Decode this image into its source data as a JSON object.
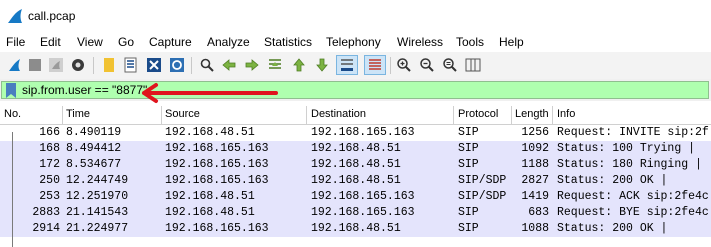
{
  "window": {
    "title": "call.pcap"
  },
  "menu": [
    "File",
    "Edit",
    "View",
    "Go",
    "Capture",
    "Analyze",
    "Statistics",
    "Telephony",
    "Wireless",
    "Tools",
    "Help"
  ],
  "toolbar": {
    "icons": [
      "start-capture-icon",
      "stop-capture-icon",
      "restart-capture-icon",
      "capture-options-icon",
      "open-file-icon",
      "save-file-icon",
      "close-file-icon",
      "reload-file-icon",
      "find-packet-icon",
      "go-back-icon",
      "go-forward-icon",
      "go-to-packet-icon",
      "go-first-icon",
      "go-last-icon",
      "autoscroll-icon",
      "colorize-icon",
      "zoom-in-icon",
      "zoom-out-icon",
      "normal-size-icon",
      "resize-columns-icon"
    ]
  },
  "filter": {
    "value": "sip.from.user == \"8877\""
  },
  "columns": [
    "No.",
    "Time",
    "Source",
    "Destination",
    "Protocol",
    "Length",
    "Info"
  ],
  "packets": [
    {
      "no": "166",
      "time": "8.490119",
      "src": "192.168.48.51",
      "dst": "192.168.165.163",
      "proto": "SIP",
      "len": "1256",
      "info": "Request: INVITE sip:2f"
    },
    {
      "no": "168",
      "time": "8.494412",
      "src": "192.168.165.163",
      "dst": "192.168.48.51",
      "proto": "SIP",
      "len": "1092",
      "info": "Status: 100 Trying |"
    },
    {
      "no": "172",
      "time": "8.534677",
      "src": "192.168.165.163",
      "dst": "192.168.48.51",
      "proto": "SIP",
      "len": "1188",
      "info": "Status: 180 Ringing |"
    },
    {
      "no": "250",
      "time": "12.244749",
      "src": "192.168.165.163",
      "dst": "192.168.48.51",
      "proto": "SIP/SDP",
      "len": "2827",
      "info": "Status: 200 OK |"
    },
    {
      "no": "253",
      "time": "12.251970",
      "src": "192.168.48.51",
      "dst": "192.168.165.163",
      "proto": "SIP/SDP",
      "len": "1419",
      "info": "Request: ACK sip:2fe4c"
    },
    {
      "no": "2883",
      "time": "21.141543",
      "src": "192.168.48.51",
      "dst": "192.168.165.163",
      "proto": "SIP",
      "len": "683",
      "info": "Request: BYE sip:2fe4c"
    },
    {
      "no": "2914",
      "time": "21.224977",
      "src": "192.168.165.163",
      "dst": "192.168.48.51",
      "proto": "SIP",
      "len": "1088",
      "info": "Status: 200 OK |"
    }
  ],
  "colors": {
    "filter_valid": "#afffaf",
    "row_bg": "#e4e4fc",
    "arrow": "#e0141e"
  }
}
